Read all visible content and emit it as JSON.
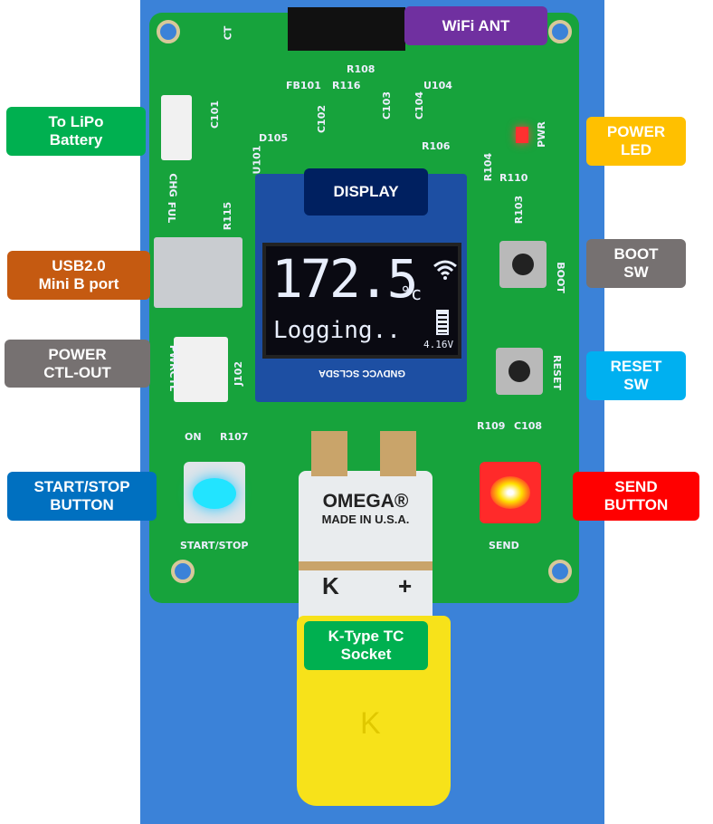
{
  "labels": {
    "wifi_ant": {
      "text": "WiFi ANT",
      "color": "#7030a0"
    },
    "lipo": {
      "text": "To LiPo\nBattery",
      "color": "#00b050"
    },
    "display": {
      "text": "DISPLAY",
      "color": "#002060"
    },
    "power_led": {
      "text": "POWER\nLED",
      "color": "#ffc000"
    },
    "usb": {
      "text": "USB2.0\nMini B port",
      "color": "#c55a11"
    },
    "boot_sw": {
      "text": "BOOT\nSW",
      "color": "#767171"
    },
    "power_ctl": {
      "text": "POWER\nCTL-OUT",
      "color": "#767171"
    },
    "reset_sw": {
      "text": "RESET\nSW",
      "color": "#00b0f0"
    },
    "start_stop": {
      "text": "START/STOP\nBUTTON",
      "color": "#0070c0"
    },
    "send": {
      "text": "SEND\nBUTTON",
      "color": "#ff0000"
    },
    "tc_socket": {
      "text": "K-Type TC\nSocket",
      "color": "#00b050"
    }
  },
  "screen": {
    "temperature": "172.5",
    "unit": "°c",
    "status": "Logging..",
    "voltage": "4.16V",
    "pins": "GNDVCC SCLSDA",
    "icons": [
      "wifi-icon",
      "battery-icon"
    ]
  },
  "silkscreen": {
    "ct": "CT",
    "r108": "R108",
    "fb101": "FB101",
    "r116": "R116",
    "c103": "C103",
    "u104": "U104",
    "c104": "C104",
    "c101": "C101",
    "d105": "D105",
    "c102": "C102",
    "r106": "R106",
    "pwr": "PWR",
    "r104": "R104",
    "r110": "R110",
    "r103": "R103",
    "chg": "CHG",
    "ful": "FUL",
    "r115": "R115",
    "u101": "U101",
    "boot": "BOOT",
    "reset": "RESET",
    "pwrctl": "PWRCTL",
    "j102": "J102",
    "on": "ON",
    "r107": "R107",
    "r109": "R109",
    "c108": "C108",
    "start_stop": "START/STOP",
    "send": "SEND"
  },
  "connector": {
    "brand": "OMEGA®",
    "made_in": "MADE IN U.S.A.",
    "neg": "K",
    "pos": "+",
    "plug_mark": "K"
  }
}
